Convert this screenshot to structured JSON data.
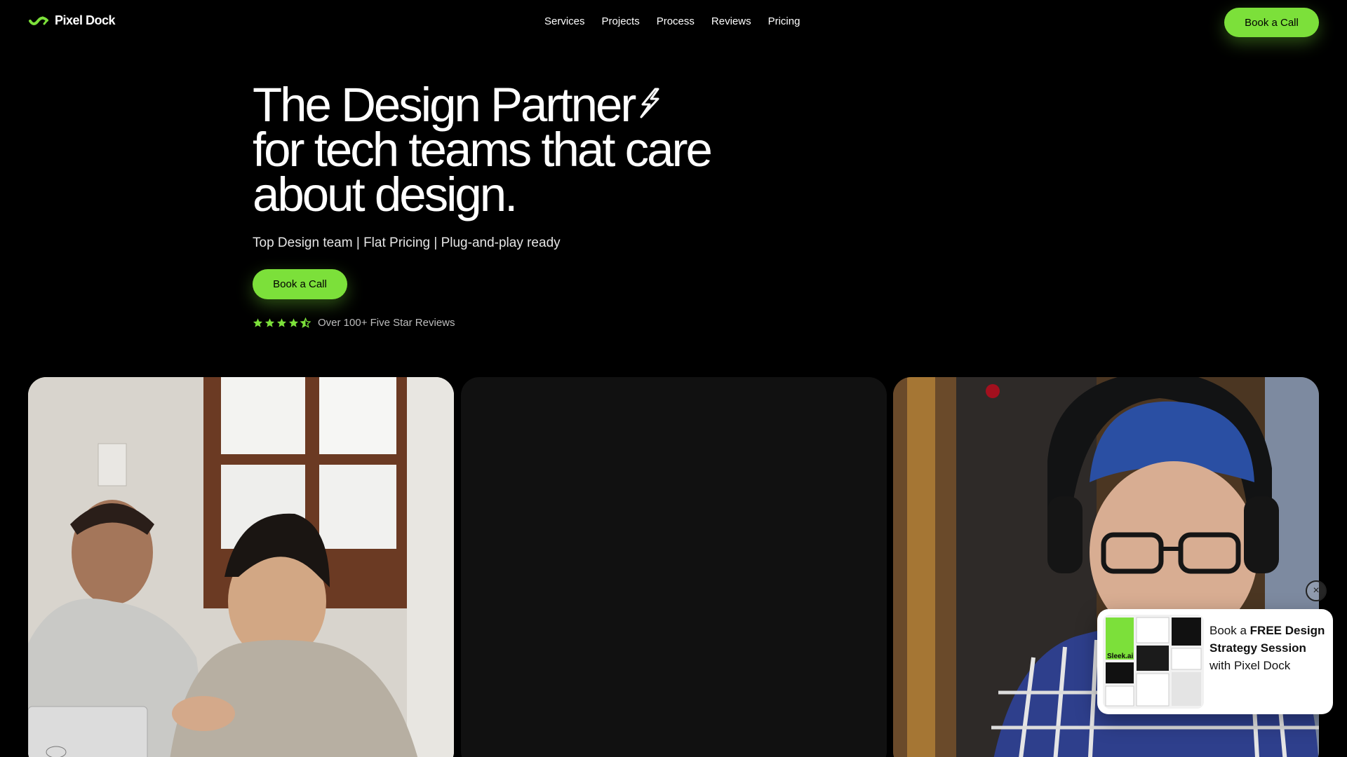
{
  "brand": {
    "name": "Pixel Dock",
    "accent": "#7ce03a"
  },
  "nav": {
    "items": [
      "Services",
      "Projects",
      "Process",
      "Reviews",
      "Pricing"
    ]
  },
  "header": {
    "cta_label": "Book a Call"
  },
  "hero": {
    "title_line1": "The Design Partner",
    "title_line2": "for tech teams that care",
    "title_line3": "about design.",
    "subtitle": "Top Design team | Flat Pricing | Plug-and-play ready",
    "cta_label": "Book a Call",
    "rating": 4.5,
    "reviews_text": "Over 100+ Five Star Reviews"
  },
  "popup": {
    "text_prefix": "Book a ",
    "text_bold": "FREE Design Strategy Session",
    "text_suffix": "with Pixel Dock",
    "thumb_label": "Sleek.ai",
    "close_icon": "close-icon"
  }
}
